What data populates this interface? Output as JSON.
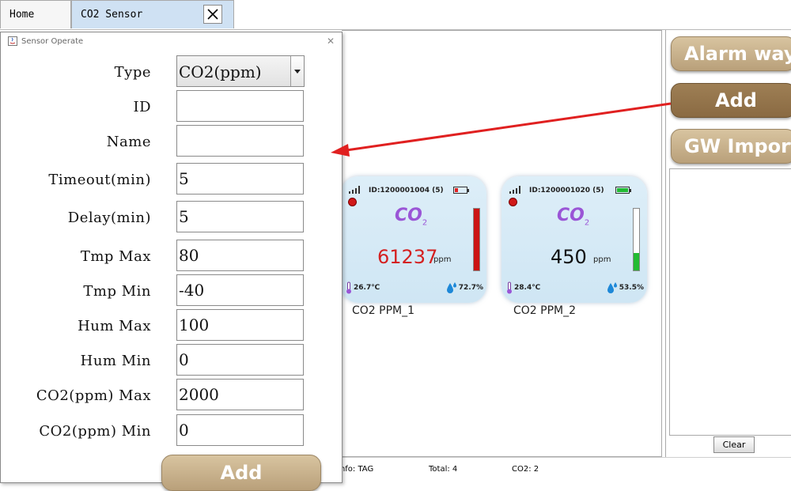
{
  "tabs": [
    {
      "label": "Home"
    },
    {
      "label": "CO2 Sensor"
    }
  ],
  "dialog": {
    "title": "Sensor Operate",
    "type_label": "Type",
    "type_value": "CO2(ppm)",
    "fields": [
      {
        "label": "ID",
        "value": ""
      },
      {
        "label": "Name",
        "value": ""
      },
      {
        "label": "Timeout(min)",
        "value": "5"
      },
      {
        "label": "Delay(min)",
        "value": "5"
      },
      {
        "label": "Tmp Max",
        "value": "80"
      },
      {
        "label": "Tmp Min",
        "value": "-40"
      },
      {
        "label": "Hum Max",
        "value": "100"
      },
      {
        "label": "Hum Min",
        "value": "0"
      },
      {
        "label": "CO2(ppm) Max",
        "value": "2000"
      },
      {
        "label": "CO2(ppm) Min",
        "value": "0"
      }
    ],
    "add_label": "Add"
  },
  "sensors": [
    {
      "id_text": "ID:1200001004 (5)",
      "co2_label": "CO",
      "co2_sub": "2",
      "value": "61237",
      "value_color": "#d42020",
      "unit": "ppm",
      "level": 1.0,
      "level_color": "#cc1414",
      "battery_level": 0.25,
      "battery_color": "#e02020",
      "temp": "26.7℃",
      "humidity": "72.7%",
      "name": "CO2 PPM_1"
    },
    {
      "id_text": "ID:1200001020 (5)",
      "co2_label": "CO",
      "co2_sub": "2",
      "value": "450",
      "value_color": "#111111",
      "unit": "ppm",
      "level": 0.28,
      "level_color": "#22bb33",
      "battery_level": 1.0,
      "battery_color": "#22bb33",
      "temp": "28.4℃",
      "humidity": "53.5%",
      "name": "CO2 PPM_2"
    }
  ],
  "right_panel": {
    "alarm_way": "Alarm way",
    "add": "Add",
    "gw_import": "GW Import",
    "clear": "Clear"
  },
  "status": {
    "info": "Info: TAG",
    "total": "Total: 4",
    "co2": "CO2:  2"
  },
  "colors": {
    "button_light": "#c8b18c",
    "button_dark": "#957649",
    "tab_active": "#cfe1f3",
    "arrow": "#e02020"
  }
}
